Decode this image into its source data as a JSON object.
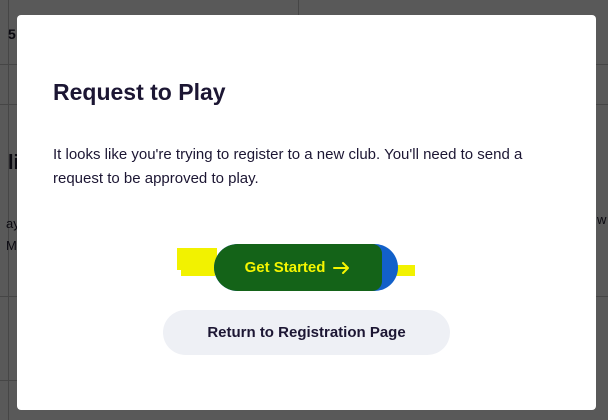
{
  "background": {
    "fragment_top": "5",
    "fragment_mid": "li",
    "fragment_left_1": "ay",
    "fragment_left_2": "My",
    "fragment_right": "w"
  },
  "modal": {
    "title": "Request to Play",
    "body": "It looks like you're trying to register to a new club. You'll need to send a request to be approved to play.",
    "primary_label": "Get Started",
    "primary_icon": "arrow-right-icon",
    "secondary_label": "Return to Registration Page"
  },
  "colors": {
    "title_text": "#1c1633",
    "primary_button_blue": "#1260c9",
    "primary_button_green": "#146318",
    "primary_button_text": "#f5f500",
    "highlight": "#f2f200",
    "secondary_button_bg": "#eef0f5"
  }
}
